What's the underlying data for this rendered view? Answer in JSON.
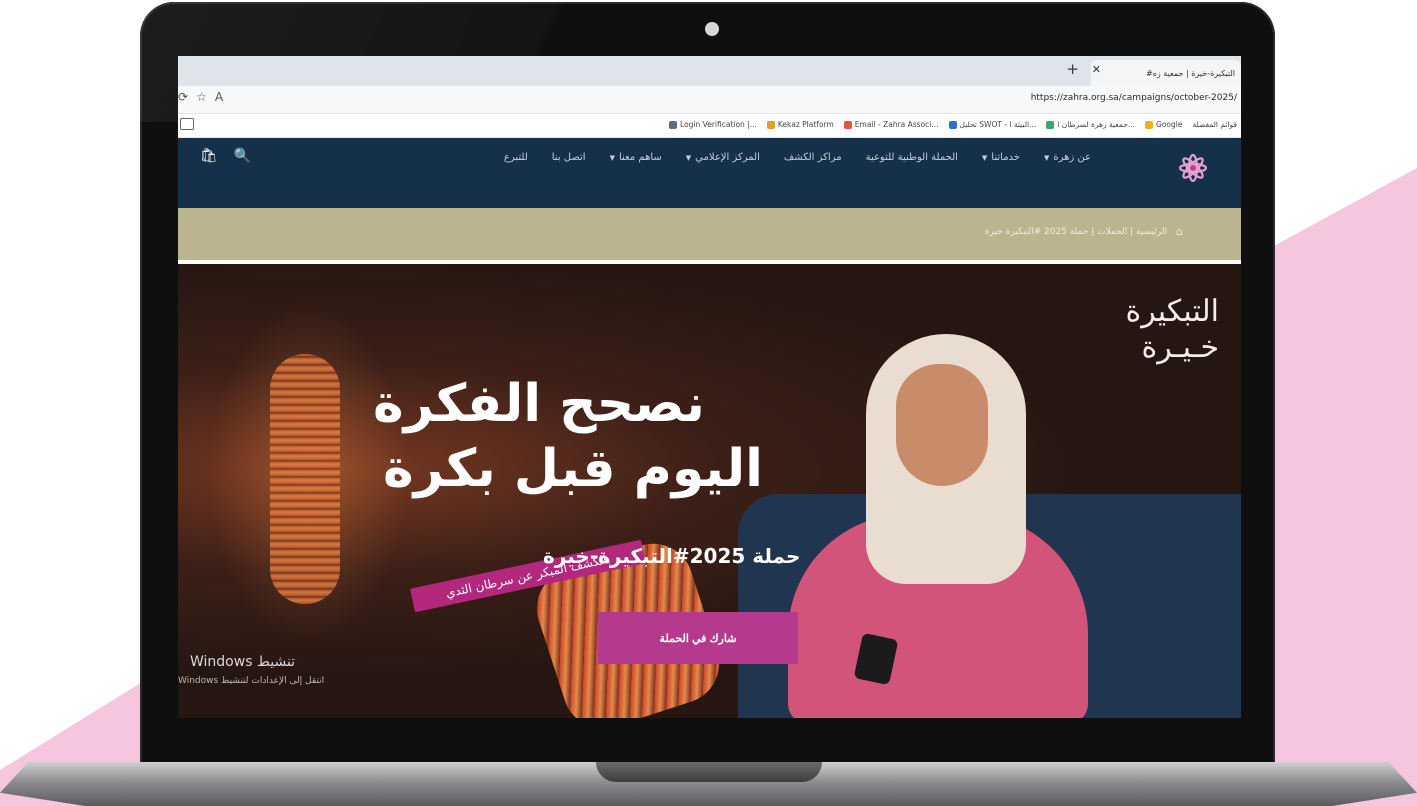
{
  "colors": {
    "site_nav": "#15304a",
    "breadcrumb_bar": "#bcb48e",
    "cta_button": "#b53a8d",
    "ribbon": "#b3287c",
    "background_accent": "#f5c6dd"
  },
  "browser": {
    "tab_title": "#التبكيرة-خيرة | جمعية زه",
    "url": "https://zahra.org.sa/campaigns/october-2025/",
    "icons": [
      "refresh-icon",
      "favorite-icon",
      "read-aloud-icon",
      "sidebar-icon"
    ],
    "bookmarks": [
      {
        "label": "قوائم المفضلة",
        "icon": ""
      },
      {
        "label": "Google",
        "icon": "google-icon"
      },
      {
        "label": "جمعية زهرة لسرطان ا...",
        "icon": "globe-icon"
      },
      {
        "label": "تحليل SWOT - البيئة ا...",
        "icon": "chart-icon"
      },
      {
        "label": "Email - Zahra Associ...",
        "icon": "outlook-icon"
      },
      {
        "label": "Kekaz Platform",
        "icon": "platform-icon"
      },
      {
        "label": "Login Verification |...",
        "icon": "verification-icon"
      }
    ]
  },
  "site": {
    "menu": [
      {
        "label": "عن زهرة",
        "dropdown": true
      },
      {
        "label": "خدماتنا",
        "dropdown": true
      },
      {
        "label": "الحملة الوطنية للتوعية",
        "dropdown": false
      },
      {
        "label": "مراكز الكشف",
        "dropdown": false
      },
      {
        "label": "المركز الإعلامي",
        "dropdown": true
      },
      {
        "label": "ساهم معنا",
        "dropdown": true
      },
      {
        "label": "اتصل بنا",
        "dropdown": false
      },
      {
        "label": "للتبرع",
        "dropdown": false
      }
    ],
    "tools": [
      "search-icon",
      "bag-icon"
    ],
    "breadcrumb": "الرئيسية | الحملات | حملة 2025 #التبكيرة خيرة"
  },
  "hero": {
    "brand_line1": "التبكيرة",
    "brand_line2": "خـيـرة",
    "headline_line1": "نصحح الفكرة",
    "headline_line2": "اليوم قبل بكرة",
    "campaign": "حملة 2025#التبكيرة-خيرة",
    "ribbon": "بالكشف المبكر عن سرطان الثدي",
    "cta": "شارك في الحملة"
  },
  "windows_watermark": {
    "title": "تنشيط Windows",
    "subtitle": "انتقل إلى الإعدادات لتنشيط Windows"
  }
}
